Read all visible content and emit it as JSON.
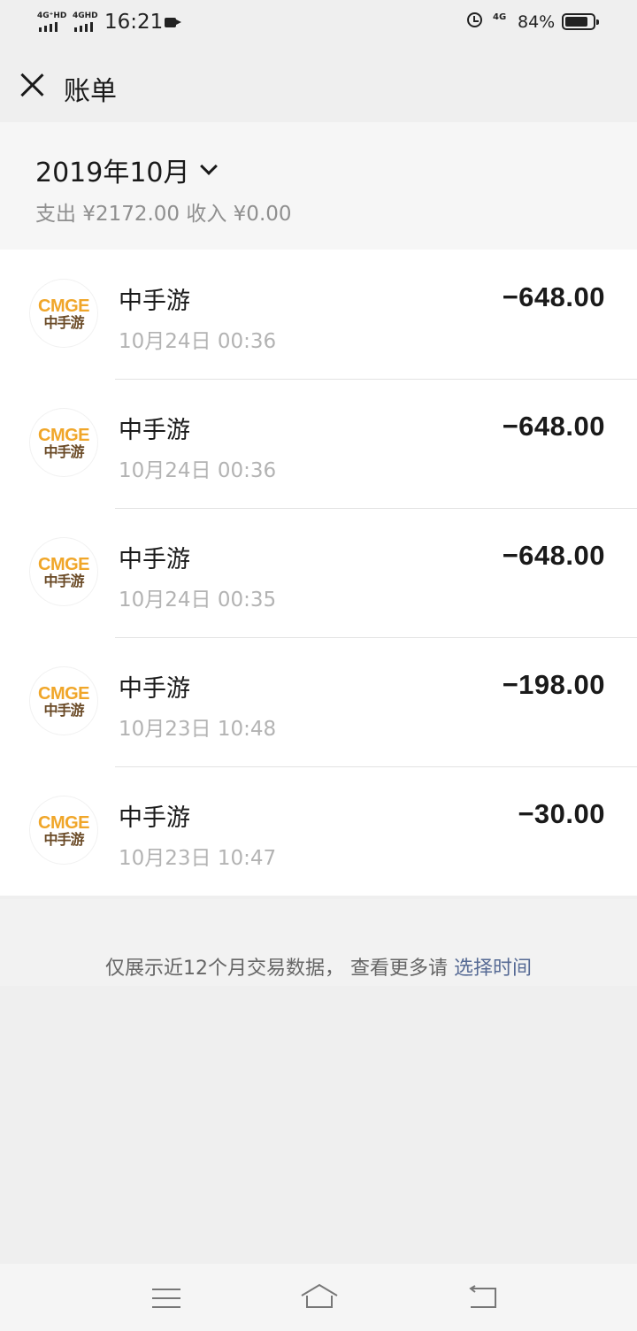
{
  "status_bar": {
    "signal1_label": "4G⁺HD",
    "signal2_label": "4GHD",
    "time": "16:21",
    "network": "4G",
    "battery_percent_text": "84%",
    "battery_level": 0.84
  },
  "nav": {
    "title": "账单"
  },
  "month_header": {
    "month": "2019年10月",
    "summary": "支出 ¥2172.00 收入 ¥0.00"
  },
  "logo": {
    "en": "CMGE",
    "cn": "中手游"
  },
  "transactions": [
    {
      "merchant": "中手游",
      "time": "10月24日 00:36",
      "amount": "−648.00"
    },
    {
      "merchant": "中手游",
      "time": "10月24日 00:36",
      "amount": "−648.00"
    },
    {
      "merchant": "中手游",
      "time": "10月24日 00:35",
      "amount": "−648.00"
    },
    {
      "merchant": "中手游",
      "time": "10月23日 10:48",
      "amount": "−198.00"
    },
    {
      "merchant": "中手游",
      "time": "10月23日 10:47",
      "amount": "−30.00"
    }
  ],
  "footer": {
    "note": "仅展示近12个月交易数据， 查看更多请 ",
    "link": "选择时间"
  },
  "colors": {
    "link": "#576b95",
    "logo_orange": "#f0a629",
    "logo_brown": "#6a4a26"
  }
}
